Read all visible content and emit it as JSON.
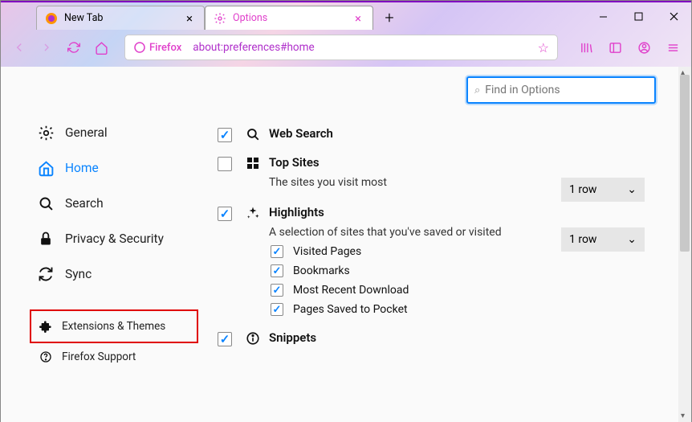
{
  "window": {
    "tabs": [
      {
        "label": "New Tab",
        "active": false,
        "icon": "firefox-logo"
      },
      {
        "label": "Options",
        "active": true,
        "icon": "gear-pink"
      }
    ]
  },
  "urlbar": {
    "identity": "Firefox",
    "url": "about:preferences#home"
  },
  "search": {
    "placeholder": "Find in Options"
  },
  "sidebar": {
    "items": [
      {
        "id": "general",
        "label": "General",
        "icon": "gear"
      },
      {
        "id": "home",
        "label": "Home",
        "icon": "home",
        "active": true
      },
      {
        "id": "search",
        "label": "Search",
        "icon": "magnifier"
      },
      {
        "id": "privacy",
        "label": "Privacy & Security",
        "icon": "lock"
      },
      {
        "id": "sync",
        "label": "Sync",
        "icon": "sync"
      }
    ],
    "footer": [
      {
        "id": "extensions",
        "label": "Extensions & Themes",
        "icon": "puzzle",
        "highlight": true
      },
      {
        "id": "support",
        "label": "Firefox Support",
        "icon": "help"
      }
    ]
  },
  "options": {
    "web_search": {
      "label": "Web Search",
      "checked": true
    },
    "top_sites": {
      "label": "Top Sites",
      "checked": false,
      "desc": "The sites you visit most",
      "rows_value": "1 row"
    },
    "highlights": {
      "label": "Highlights",
      "checked": true,
      "desc": "A selection of sites that you've saved or visited",
      "rows_value": "1 row",
      "subs": [
        {
          "label": "Visited Pages",
          "checked": true
        },
        {
          "label": "Bookmarks",
          "checked": true
        },
        {
          "label": "Most Recent Download",
          "checked": true
        },
        {
          "label": "Pages Saved to Pocket",
          "checked": true
        }
      ]
    },
    "snippets": {
      "label": "Snippets",
      "checked": true
    }
  }
}
